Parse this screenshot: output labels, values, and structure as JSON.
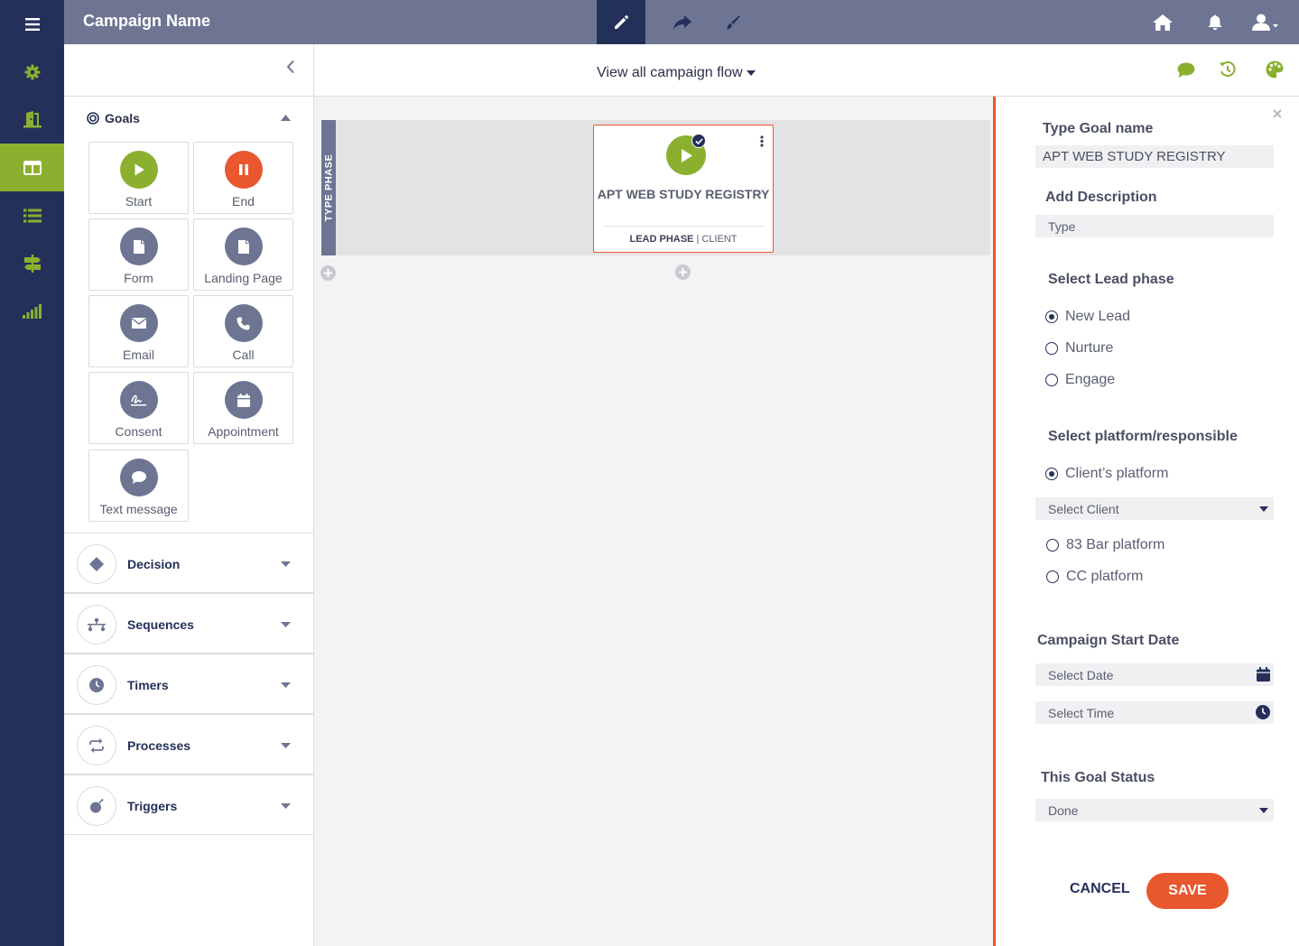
{
  "header": {
    "title": "Campaign Name"
  },
  "canvas": {
    "flow_select": "View all campaign flow",
    "phase_label": "TYPE PHASE",
    "node": {
      "title": "APT WEB STUDY REGISTRY",
      "phase": "LEAD PHASE",
      "separator": " | ",
      "owner": "CLIENT"
    }
  },
  "palette": {
    "goals_label": "Goals",
    "tiles": [
      {
        "label": "Start",
        "icon": "play-icon",
        "color": "#8bb02f"
      },
      {
        "label": "End",
        "icon": "pause-icon",
        "color": "#e8572d"
      },
      {
        "label": "Form",
        "icon": "document-icon",
        "color": "#6d7593"
      },
      {
        "label": "Landing Page",
        "icon": "document-icon",
        "color": "#6d7593"
      },
      {
        "label": "Email",
        "icon": "envelope-icon",
        "color": "#6d7593"
      },
      {
        "label": "Call",
        "icon": "phone-icon",
        "color": "#6d7593"
      },
      {
        "label": "Consent",
        "icon": "signature-icon",
        "color": "#6d7593"
      },
      {
        "label": "Appointment",
        "icon": "calendar-icon",
        "color": "#6d7593"
      },
      {
        "label": "Text message",
        "icon": "chat-icon",
        "color": "#6d7593"
      }
    ],
    "sections": [
      {
        "label": "Decision",
        "icon": "diamond-icon"
      },
      {
        "label": "Sequences",
        "icon": "sequence-icon"
      },
      {
        "label": "Timers",
        "icon": "clock-icon"
      },
      {
        "label": "Processes",
        "icon": "repeat-icon"
      },
      {
        "label": "Triggers",
        "icon": "bomb-icon"
      }
    ]
  },
  "panel": {
    "goal_name_label": "Type Goal name",
    "goal_name_value": "APT WEB STUDY REGISTRY",
    "description_label": "Add Description",
    "description_placeholder": "Type",
    "lead_phase_label": "Select Lead phase",
    "lead_phases": [
      {
        "label": "New Lead",
        "selected": true
      },
      {
        "label": "Nurture",
        "selected": false
      },
      {
        "label": "Engage",
        "selected": false
      }
    ],
    "platform_label": "Select platform/responsible",
    "platform_client": {
      "label": "Client’s platform",
      "selected": true
    },
    "client_select": "Select Client",
    "platform_others": [
      {
        "label": "83 Bar platform",
        "selected": false
      },
      {
        "label": "CC platform",
        "selected": false
      }
    ],
    "start_date_label": "Campaign Start Date",
    "date_placeholder": "Select Date",
    "time_placeholder": "Select Time",
    "status_label": "This Goal Status",
    "status_value": "Done",
    "cancel_label": "CANCEL",
    "save_label": "SAVE"
  },
  "colors": {
    "navy": "#243059",
    "slate": "#6d7593",
    "green": "#8bb02f",
    "orange": "#e8572d"
  }
}
